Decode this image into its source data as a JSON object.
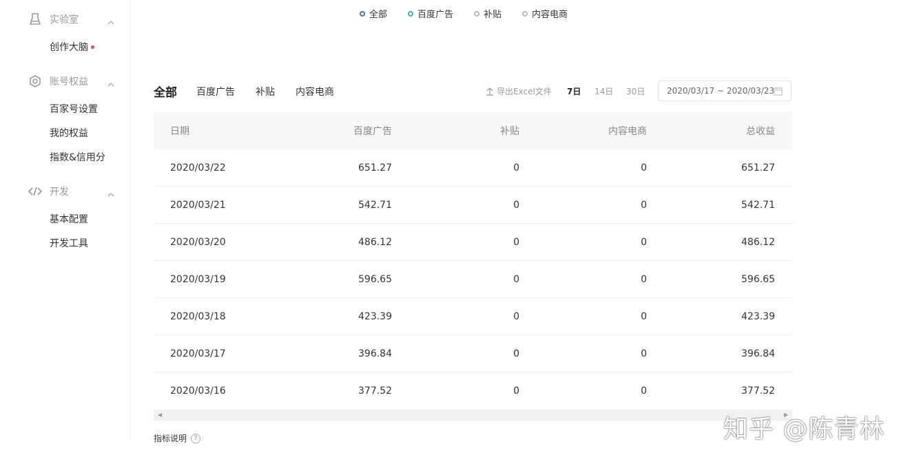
{
  "sidebar": {
    "groups": [
      {
        "label": "实验室",
        "icon": "lab-icon",
        "items": [
          {
            "label": "创作大脑",
            "dot": true
          }
        ]
      },
      {
        "label": "账号权益",
        "icon": "hexagon-gear-icon",
        "items": [
          {
            "label": "百家号设置"
          },
          {
            "label": "我的权益"
          },
          {
            "label": "指数&信用分"
          }
        ]
      },
      {
        "label": "开发",
        "icon": "code-icon",
        "items": [
          {
            "label": "基本配置"
          },
          {
            "label": "开发工具"
          }
        ]
      }
    ]
  },
  "legend": [
    "全部",
    "百度广告",
    "补贴",
    "内容电商"
  ],
  "legend_colors": [
    "#4a6fa5",
    "#36b3a2",
    "#bbbbbb",
    "#bbbbbb"
  ],
  "tabs": {
    "active": "全部",
    "others": [
      "百度广告",
      "补贴",
      "内容电商"
    ]
  },
  "toolbar": {
    "export_label": "导出Excel文件",
    "ranges": [
      "7日",
      "14日",
      "30日"
    ],
    "active_range": "7日",
    "date_range": "2020/03/17 ~ 2020/03/23"
  },
  "table": {
    "headers": [
      "日期",
      "百度广告",
      "补贴",
      "内容电商",
      "总收益"
    ],
    "rows": [
      [
        "2020/03/22",
        "651.27",
        "0",
        "0",
        "651.27"
      ],
      [
        "2020/03/21",
        "542.71",
        "0",
        "0",
        "542.71"
      ],
      [
        "2020/03/20",
        "486.12",
        "0",
        "0",
        "486.12"
      ],
      [
        "2020/03/19",
        "596.65",
        "0",
        "0",
        "596.65"
      ],
      [
        "2020/03/18",
        "423.39",
        "0",
        "0",
        "423.39"
      ],
      [
        "2020/03/17",
        "396.84",
        "0",
        "0",
        "396.84"
      ],
      [
        "2020/03/16",
        "377.52",
        "0",
        "0",
        "377.52"
      ]
    ]
  },
  "footer": {
    "indicator_label": "指标说明",
    "help_glyph": "?"
  },
  "watermark": "知乎 @陈青林"
}
